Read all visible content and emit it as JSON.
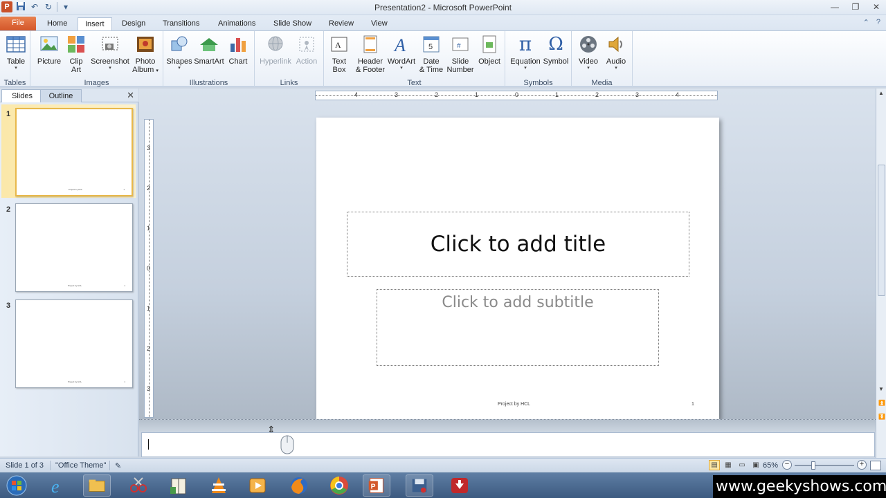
{
  "window": {
    "title": "Presentation2 - Microsoft PowerPoint",
    "app_logo": "P"
  },
  "ribbon_tabs": [
    {
      "label": "File"
    },
    {
      "label": "Home"
    },
    {
      "label": "Insert"
    },
    {
      "label": "Design"
    },
    {
      "label": "Transitions"
    },
    {
      "label": "Animations"
    },
    {
      "label": "Slide Show"
    },
    {
      "label": "Review"
    },
    {
      "label": "View"
    }
  ],
  "active_tab": "Insert",
  "groups": {
    "tables": {
      "label": "Tables",
      "buttons": [
        {
          "label": "Table",
          "icon": "table-icon"
        }
      ]
    },
    "images": {
      "label": "Images",
      "buttons": [
        {
          "label": "Picture",
          "icon": "picture-icon"
        },
        {
          "label": "Clip",
          "label2": "Art",
          "icon": "clip-art-icon"
        },
        {
          "label": "Screenshot",
          "icon": "screenshot-icon"
        },
        {
          "label": "Photo",
          "label2": "Album",
          "icon": "photo-album-icon"
        }
      ]
    },
    "illustrations": {
      "label": "Illustrations",
      "buttons": [
        {
          "label": "Shapes",
          "icon": "shapes-icon"
        },
        {
          "label": "SmartArt",
          "icon": "smartart-icon"
        },
        {
          "label": "Chart",
          "icon": "chart-icon"
        }
      ]
    },
    "links": {
      "label": "Links",
      "buttons": [
        {
          "label": "Hyperlink",
          "icon": "hyperlink-icon"
        },
        {
          "label": "Action",
          "icon": "action-icon"
        }
      ]
    },
    "text": {
      "label": "Text",
      "buttons": [
        {
          "label": "Text",
          "label2": "Box",
          "icon": "text-box-icon"
        },
        {
          "label": "Header",
          "label2": "& Footer",
          "icon": "header-footer-icon"
        },
        {
          "label": "WordArt",
          "icon": "wordart-icon"
        },
        {
          "label": "Date",
          "label2": "& Time",
          "icon": "date-time-icon"
        },
        {
          "label": "Slide",
          "label2": "Number",
          "icon": "slide-number-icon"
        },
        {
          "label": "Object",
          "icon": "object-icon"
        }
      ]
    },
    "symbols": {
      "label": "Symbols",
      "buttons": [
        {
          "label": "Equation",
          "icon": "equation-icon",
          "glyph": "π"
        },
        {
          "label": "Symbol",
          "icon": "symbol-icon",
          "glyph": "Ω"
        }
      ]
    },
    "media": {
      "label": "Media",
      "buttons": [
        {
          "label": "Video",
          "icon": "video-icon"
        },
        {
          "label": "Audio",
          "icon": "audio-icon"
        }
      ]
    }
  },
  "panel": {
    "tab_slides": "Slides",
    "tab_outline": "Outline",
    "close_glyph": "✕",
    "slides": [
      {
        "num": "1",
        "selected": true
      },
      {
        "num": "2",
        "selected": false
      },
      {
        "num": "3",
        "selected": false
      }
    ]
  },
  "ruler": {
    "h_numbers": [
      "4",
      "3",
      "2",
      "1",
      "0",
      "1",
      "2",
      "3",
      "4"
    ],
    "v_numbers": [
      "3",
      "2",
      "1",
      "0",
      "1",
      "2",
      "3"
    ]
  },
  "slide": {
    "title_placeholder": "Click to add title",
    "subtitle_placeholder": "Click to add subtitle",
    "footer": "Project  by HCL",
    "number": "1"
  },
  "statusbar": {
    "slide_info": "Slide 1 of 3",
    "theme": "\"Office Theme\"",
    "zoom": "65%",
    "zoom_minus": "−",
    "zoom_plus": "+"
  },
  "taskbar": {
    "apps": [
      "start-orb",
      "internet-explorer",
      "file-explorer",
      "snipping-tool",
      "book-app",
      "vlc",
      "media-player",
      "firefox",
      "chrome",
      "powerpoint",
      "save-app",
      "download-app"
    ]
  },
  "watermark": "www.geekyshows.com",
  "colors": {
    "file_tab": "#d3572a",
    "ribbon_bg": "#e9eff7",
    "selected_thumb": "#e8b84a"
  }
}
